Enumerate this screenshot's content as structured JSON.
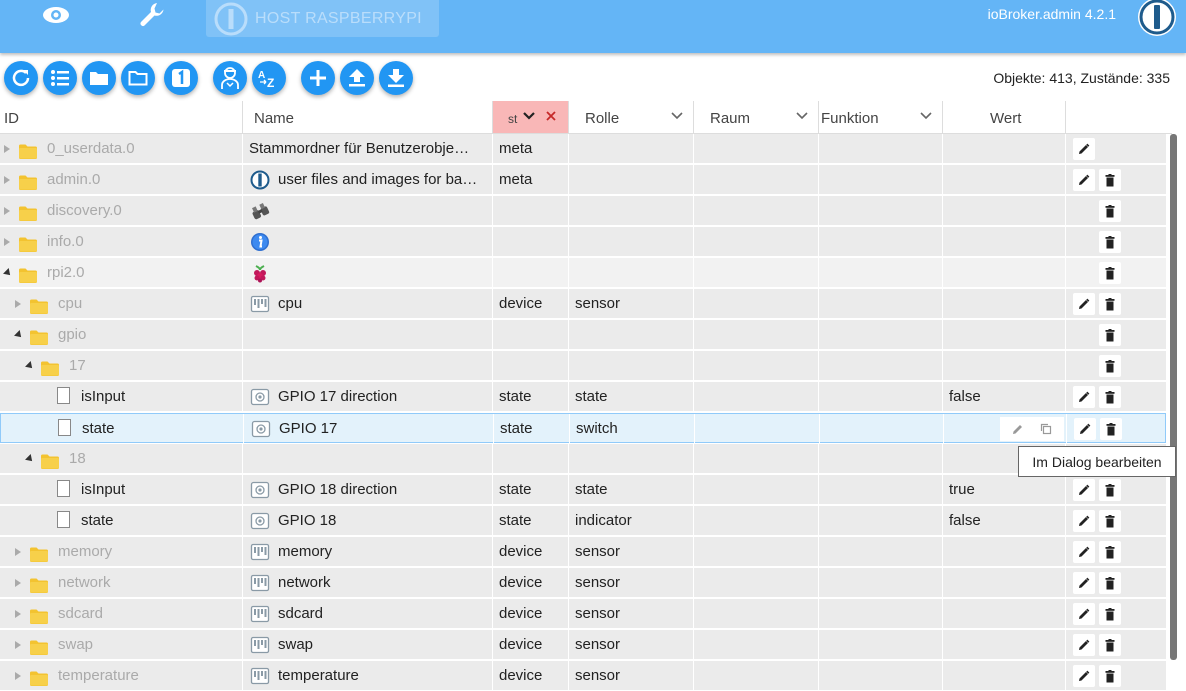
{
  "app": {
    "host_label": "HOST RASPBERRYPI",
    "version": "ioBroker.admin 4.2.1"
  },
  "toolbar": {
    "stats": "Objekte: 413, Zustände: 335",
    "buttons": [
      "refresh-icon",
      "list-icon",
      "folder-icon",
      "folder-outline-icon",
      "one-icon",
      "expert-icon",
      "sort-az-icon",
      "add-icon",
      "upload-icon",
      "download-icon"
    ]
  },
  "columns": {
    "id": "ID",
    "name": "Name",
    "state": "st",
    "role": "Rolle",
    "room": "Raum",
    "function": "Funktion",
    "value": "Wert"
  },
  "rows": [
    {
      "id": "0_userdata.0",
      "name": "Stammordner für Benutzerobje…",
      "type": "meta",
      "role": "",
      "value": "",
      "icon": "",
      "expanded": false,
      "depth": 0,
      "kind": "folder",
      "edit": true,
      "del": false
    },
    {
      "id": "admin.0",
      "name": "user files and images for ba…",
      "type": "meta",
      "role": "",
      "value": "",
      "icon": "iobroker-icon",
      "expanded": false,
      "depth": 0,
      "kind": "folder",
      "edit": true,
      "del": true
    },
    {
      "id": "discovery.0",
      "name": "",
      "type": "",
      "role": "",
      "value": "",
      "icon": "binoculars-icon",
      "expanded": false,
      "depth": 0,
      "kind": "folder",
      "edit": false,
      "del": true
    },
    {
      "id": "info.0",
      "name": "",
      "type": "",
      "role": "",
      "value": "",
      "icon": "info-icon",
      "expanded": false,
      "depth": 0,
      "kind": "folder",
      "edit": false,
      "del": true
    },
    {
      "id": "rpi2.0",
      "name": "",
      "type": "",
      "role": "",
      "value": "",
      "icon": "raspberry-icon",
      "expanded": true,
      "depth": 0,
      "kind": "folder",
      "edit": false,
      "del": true
    },
    {
      "id": "cpu",
      "name": "cpu",
      "type": "device",
      "role": "sensor",
      "value": "",
      "icon": "device-icon",
      "expanded": false,
      "depth": 1,
      "kind": "folder",
      "edit": true,
      "del": true
    },
    {
      "id": "gpio",
      "name": "",
      "type": "",
      "role": "",
      "value": "",
      "icon": "",
      "expanded": true,
      "depth": 1,
      "kind": "folder",
      "edit": false,
      "del": true
    },
    {
      "id": "17",
      "name": "",
      "type": "",
      "role": "",
      "value": "",
      "icon": "",
      "expanded": true,
      "depth": 2,
      "kind": "folder",
      "edit": false,
      "del": true
    },
    {
      "id": "isInput",
      "name": "GPIO 17 direction",
      "type": "state",
      "role": "state",
      "value": "false",
      "icon": "state-icon",
      "depth": 3,
      "kind": "file",
      "edit": true,
      "del": true
    },
    {
      "id": "state",
      "name": "GPIO 17",
      "type": "state",
      "role": "switch",
      "value": "",
      "icon": "state-icon",
      "depth": 3,
      "kind": "file",
      "edit": true,
      "del": true,
      "selected": true
    },
    {
      "id": "18",
      "name": "",
      "type": "",
      "role": "",
      "value": "",
      "icon": "",
      "expanded": true,
      "depth": 2,
      "kind": "folder",
      "edit": false,
      "del": false
    },
    {
      "id": "isInput",
      "name": "GPIO 18 direction",
      "type": "state",
      "role": "state",
      "value": "true",
      "icon": "state-icon",
      "depth": 3,
      "kind": "file",
      "edit": true,
      "del": true
    },
    {
      "id": "state",
      "name": "GPIO 18",
      "type": "state",
      "role": "indicator",
      "value": "false",
      "icon": "state-icon",
      "depth": 3,
      "kind": "file",
      "edit": true,
      "del": true
    },
    {
      "id": "memory",
      "name": "memory",
      "type": "device",
      "role": "sensor",
      "value": "",
      "icon": "device-icon",
      "expanded": false,
      "depth": 1,
      "kind": "folder",
      "edit": true,
      "del": true
    },
    {
      "id": "network",
      "name": "network",
      "type": "device",
      "role": "sensor",
      "value": "",
      "icon": "device-icon",
      "expanded": false,
      "depth": 1,
      "kind": "folder",
      "edit": true,
      "del": true
    },
    {
      "id": "sdcard",
      "name": "sdcard",
      "type": "device",
      "role": "sensor",
      "value": "",
      "icon": "device-icon",
      "expanded": false,
      "depth": 1,
      "kind": "folder",
      "edit": true,
      "del": true
    },
    {
      "id": "swap",
      "name": "swap",
      "type": "device",
      "role": "sensor",
      "value": "",
      "icon": "device-icon",
      "expanded": false,
      "depth": 1,
      "kind": "folder",
      "edit": true,
      "del": true
    },
    {
      "id": "temperature",
      "name": "temperature",
      "type": "device",
      "role": "sensor",
      "value": "",
      "icon": "device-icon",
      "expanded": false,
      "depth": 1,
      "kind": "folder",
      "edit": true,
      "del": true
    }
  ],
  "tooltip": "Im Dialog bearbeiten",
  "colors": {
    "topbar": "#64b5f6",
    "button": "#2196f3",
    "state_column": "#f9b7b7",
    "folder": "#f3c330"
  }
}
